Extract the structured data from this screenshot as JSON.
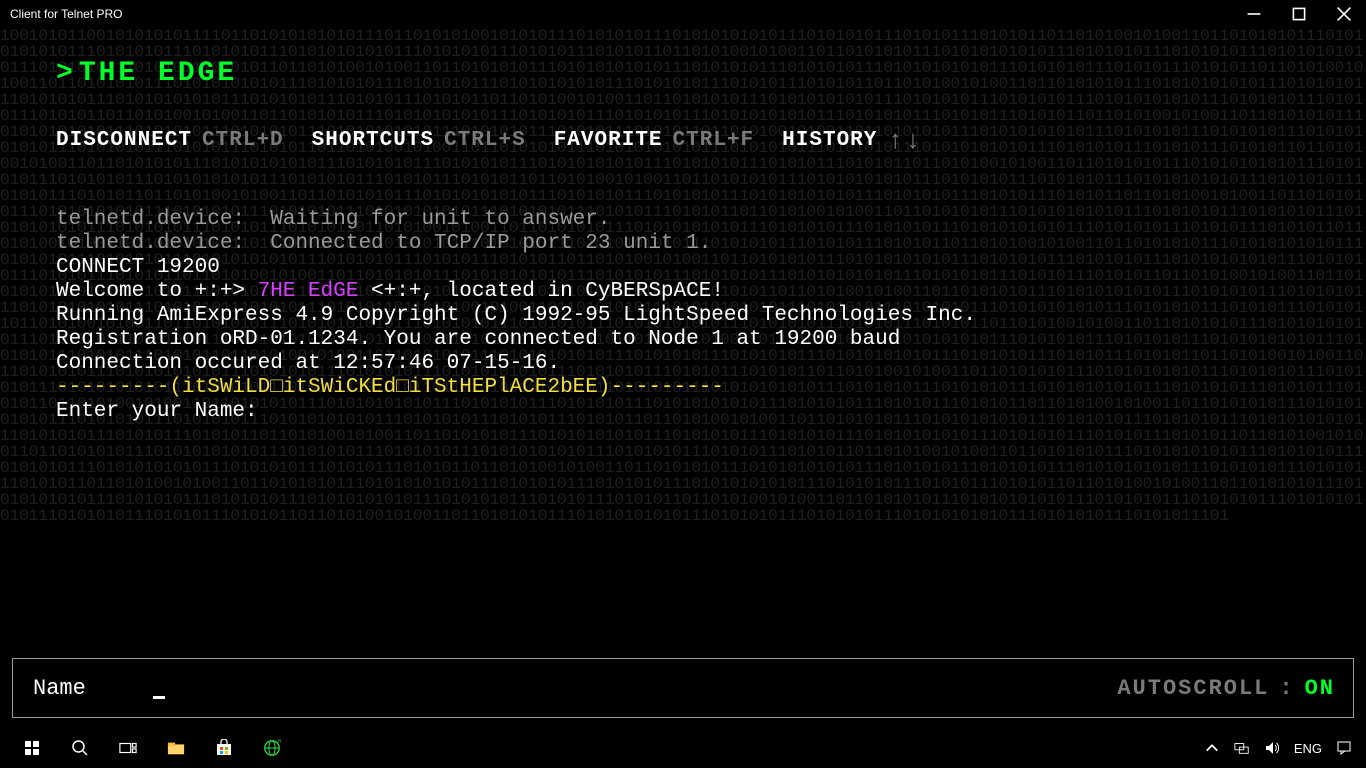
{
  "window": {
    "title": "Client for Telnet PRO"
  },
  "header": {
    "prompt_prefix": ">",
    "prompt_title": "THE EDGE"
  },
  "menu": {
    "disconnect": {
      "label": "DISCONNECT",
      "shortcut": "CTRL+D"
    },
    "shortcuts": {
      "label": "SHORTCUTS",
      "shortcut": "CTRL+S"
    },
    "favorite": {
      "label": "FAVORITE",
      "shortcut": "CTRL+F"
    },
    "history": {
      "label": "HISTORY"
    }
  },
  "terminal": {
    "line1": "telnetd.device:  Waiting for unit to answer.",
    "line2": "telnetd.device:  Connected to TCP/IP port 23 unit 1.",
    "blank1": "",
    "connect": "CONNECT 19200",
    "blank2": "",
    "welcome_pre": "Welcome to +:+> ",
    "welcome_name": "7HE EdGE",
    "welcome_post": " <+:+, located in CyBERSpACE!",
    "line6": "Running AmiExpress 4.9 Copyright (C) 1992-95 LightSpeed Technologies Inc.",
    "line7": "Registration oRD-01.1234. You are connected to Node 1 at 19200 baud",
    "line8": "Connection occured at 12:57:46 07-15-16.",
    "blank3": "",
    "tag": "---------(itSWiLD□itSWiCKEd□iTStHEPlACE2bEE)---------",
    "blank4": "",
    "blank5": "",
    "prompt": "Enter your Name:"
  },
  "input": {
    "value": "Name",
    "placeholder": ""
  },
  "status": {
    "autoscroll_label": "AUTOSCROLL",
    "sep": ":",
    "autoscroll_value": "ON"
  },
  "tray": {
    "lang": "ENG"
  }
}
